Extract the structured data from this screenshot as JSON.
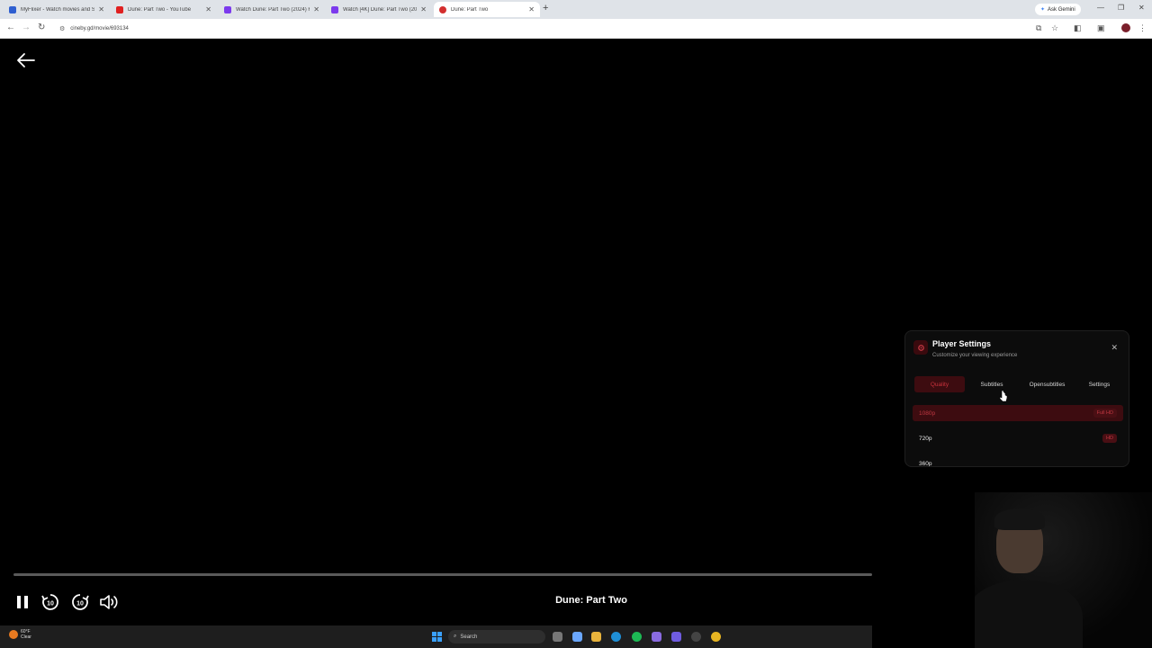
{
  "browser": {
    "tabs": [
      {
        "title": "MyFlixer - Watch movies and S",
        "favicon_color": "#2f5fd0"
      },
      {
        "title": "Dune: Part Two - YouTube",
        "favicon_color": "#e02020"
      },
      {
        "title": "Watch Dune: Part Two (2024) Fr",
        "favicon_color": "#7c3aed"
      },
      {
        "title": "Watch [4K] Dune: Part Two (202",
        "favicon_color": "#7c3aed"
      },
      {
        "title": "Dune: Part Two",
        "favicon_color": "#d32f2f"
      }
    ],
    "active_tab_index": 4,
    "ask_gemini": "Ask Gemini",
    "url": "cineby.gd/movie/693134"
  },
  "player": {
    "movie_title": "Dune: Part Two",
    "progress_fraction": 0.0
  },
  "settings": {
    "title": "Player Settings",
    "subtitle": "Customize your viewing experience",
    "tabs": [
      "Quality",
      "Subtitles",
      "Opensubtitles",
      "Settings"
    ],
    "active_tab": "Quality",
    "qualities": [
      {
        "label": "1080p",
        "badge": "Full HD",
        "selected": true
      },
      {
        "label": "720p",
        "badge": "HD",
        "selected": false
      },
      {
        "label": "360p",
        "badge": "",
        "selected": false
      }
    ],
    "accent_color": "#c23842"
  },
  "taskbar": {
    "temperature": "60°F",
    "weather": "Clear",
    "search_placeholder": "Search"
  }
}
